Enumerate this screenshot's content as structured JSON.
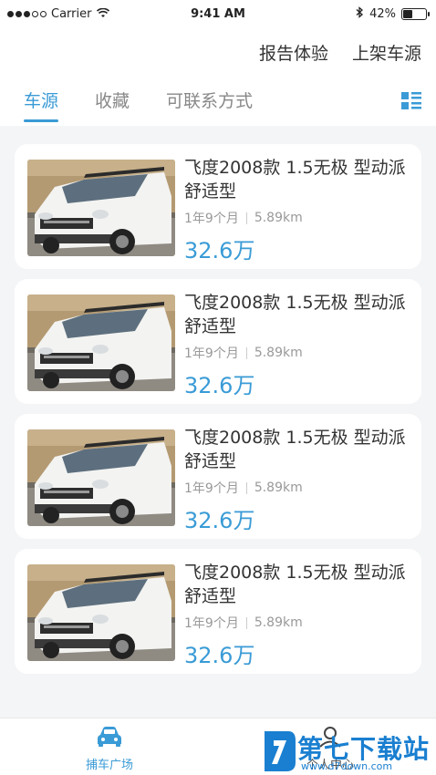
{
  "status_bar": {
    "carrier": "Carrier",
    "time": "9:41 AM",
    "battery": "42%",
    "battery_level": 0.42
  },
  "header": {
    "actions": [
      "报告体验",
      "上架车源"
    ],
    "tabs": [
      "车源",
      "收藏",
      "可联系方式"
    ],
    "active_tab": 0
  },
  "listings": [
    {
      "title": "飞度2008款 1.5无极 型动派舒适型",
      "age": "1年9个月",
      "mileage": "5.89km",
      "price": "32.6万"
    },
    {
      "title": "飞度2008款 1.5无极 型动派舒适型",
      "age": "1年9个月",
      "mileage": "5.89km",
      "price": "32.6万"
    },
    {
      "title": "飞度2008款 1.5无极 型动派舒适型",
      "age": "1年9个月",
      "mileage": "5.89km",
      "price": "32.6万"
    },
    {
      "title": "飞度2008款 1.5无极 型动派舒适型",
      "age": "1年9个月",
      "mileage": "5.89km",
      "price": "32.6万"
    }
  ],
  "tabbar": {
    "items": [
      "捕车广场",
      "个人中心"
    ],
    "active": 0
  },
  "watermark": {
    "text": "第七下载站",
    "url": "www.d7down.com"
  },
  "colors": {
    "accent": "#3a9bd6",
    "background": "#f4f5f7"
  }
}
